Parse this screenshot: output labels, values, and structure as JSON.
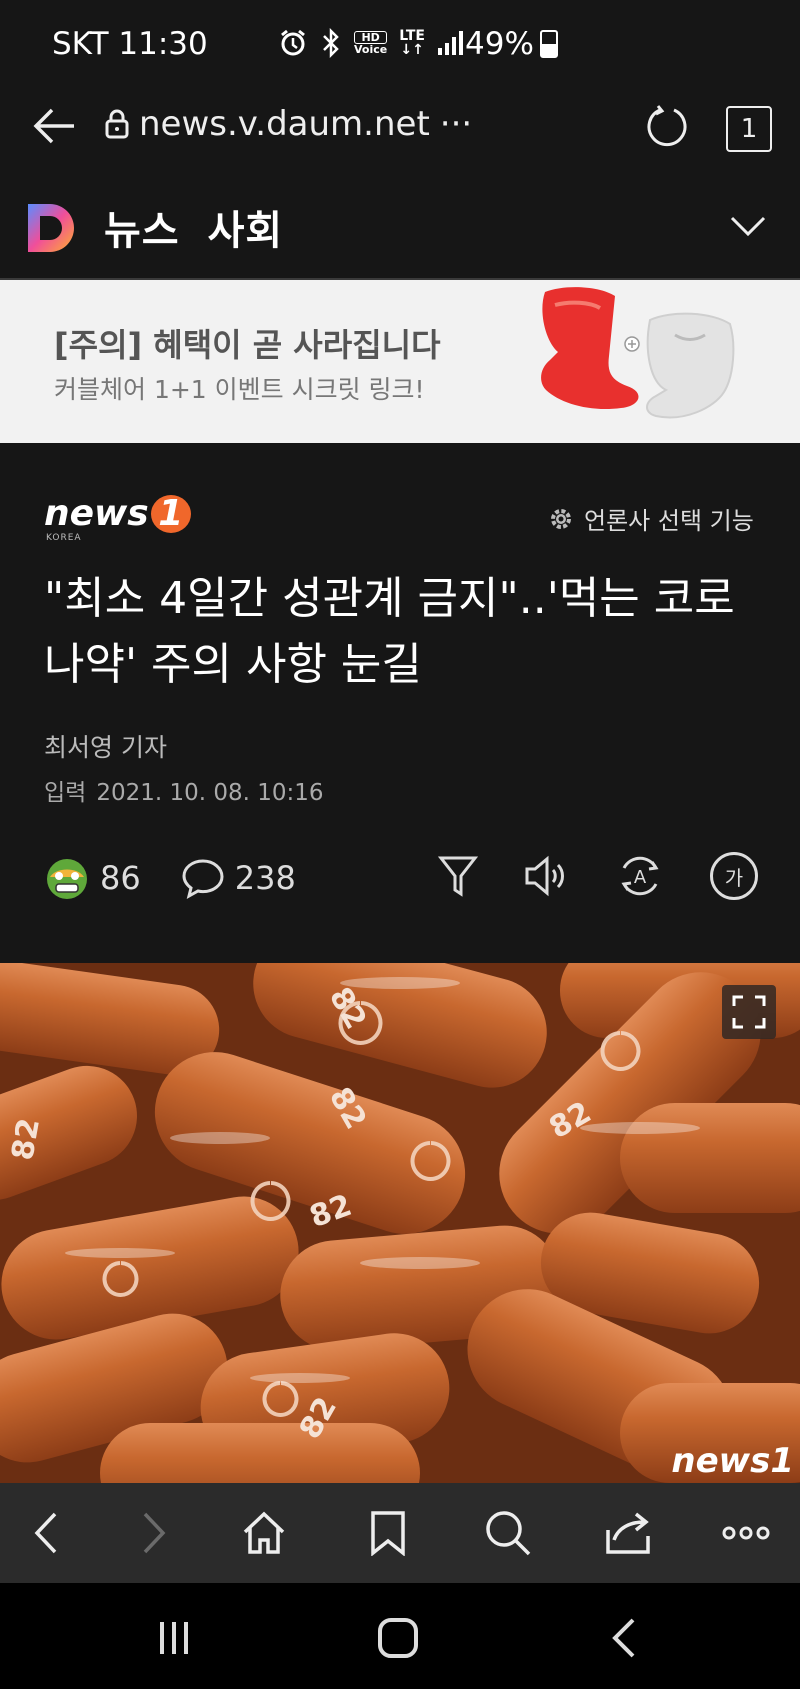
{
  "status_bar": {
    "carrier_time": "SKT 11:30",
    "battery": "49%",
    "network": "LTE",
    "hd_voice": "HD Voice"
  },
  "address_bar": {
    "url": "news.v.daum.net",
    "more": "···",
    "tab_count": "1"
  },
  "daum_header": {
    "section": "뉴스",
    "category": "사회"
  },
  "ad": {
    "title": "[주의] 혜택이 곧 사라집니다",
    "subtitle": "커블체어 1+1 이벤트 시크릿 링크!"
  },
  "article": {
    "press": "news",
    "press_number": "1",
    "press_sub": "KOREA",
    "press_select": "언론사 선택 기능",
    "headline": "\"최소 4일간 성관계 금지\"..'먹는 코로나약' 주의 사항 눈길",
    "reporter": "최서영 기자",
    "date_label": "입력",
    "date_value": "2021. 10. 08. 10:16",
    "reaction_count": "86",
    "comment_count": "238",
    "font_button": "가"
  },
  "photo": {
    "watermark": "news1"
  },
  "colors": {
    "background": "#161616",
    "ad_background": "#f2f2f2",
    "press_accent": "#f0672b",
    "toolbar": "#2b2b2b"
  }
}
